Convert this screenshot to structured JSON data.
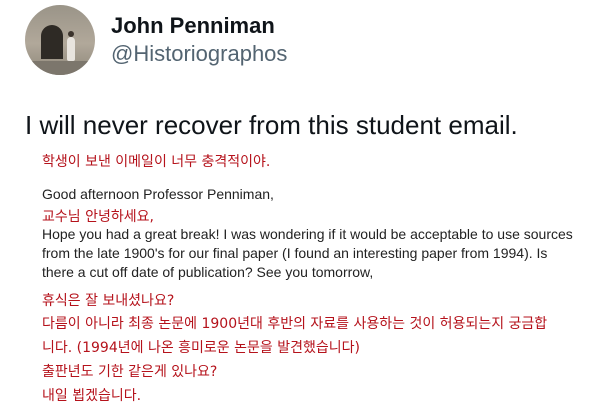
{
  "author": {
    "display_name": "John Penniman",
    "handle": "@Historiographos"
  },
  "tweet": {
    "text": "I will never recover from this student email."
  },
  "attachment": {
    "caption_kr": "학생이 보낸 이메일이 너무 충격적이야.",
    "greeting_en": "Good afternoon Professor Penniman,",
    "greeting_kr": "교수님 안녕하세요,",
    "body_en_1": "Hope you had a great break! I was wondering if it would be acceptable to use sources",
    "body_en_2": "from the late 1900's for our final paper (I found an interesting paper from 1994). Is",
    "body_en_3": "there a cut off date of publication? See you tomorrow,",
    "kr_1": "휴식은 잘 보내셨나요?",
    "kr_2": "다름이 아니라 최종 논문에 1900년대 후반의 자료를 사용하는 것이 허용되는지 궁금합",
    "kr_3": "니다. (1994년에 나온 흥미로운 논문을 발견했습니다)",
    "kr_4": "출판년도 기한 같은게 있나요?",
    "kr_5": "내일 뵙겠습니다."
  }
}
